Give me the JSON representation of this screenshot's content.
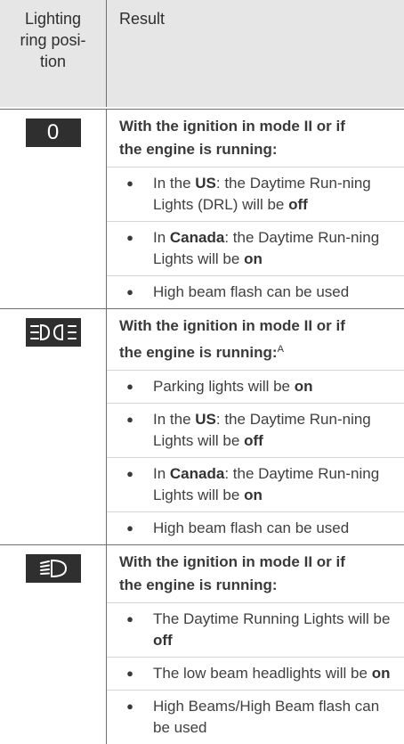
{
  "header": {
    "left_line1": "Lighting",
    "left_line2": "ring posi-",
    "left_line3": "tion",
    "right": "Result"
  },
  "sections": [
    {
      "badge_label": "0",
      "condition_line1": "With the ignition in mode II or if",
      "condition_line2": "the engine is running:",
      "footnote": "",
      "items": [
        {
          "pre": "In the ",
          "b1": "US",
          "mid": ": the Daytime Run-ning Lights (DRL) will be ",
          "b2": "off"
        },
        {
          "pre": "In ",
          "b1": "Canada",
          "mid": ": the Daytime Run-ning Lights will be ",
          "b2": "on"
        },
        {
          "pre": "High beam flash can be used",
          "b1": "",
          "mid": "",
          "b2": ""
        }
      ]
    },
    {
      "badge_icon": "parking-lights-icon",
      "condition_line1": "With the ignition in mode II or if",
      "condition_line2": "the engine is running:",
      "footnote": "A",
      "items": [
        {
          "pre": "Parking lights will be ",
          "b1": "on",
          "mid": "",
          "b2": ""
        },
        {
          "pre": "In the ",
          "b1": "US",
          "mid": ": the Daytime Run-ning Lights will be ",
          "b2": "off"
        },
        {
          "pre": "In ",
          "b1": "Canada",
          "mid": ": the Daytime Run-ning Lights will be ",
          "b2": "on"
        },
        {
          "pre": "High beam flash can be used",
          "b1": "",
          "mid": "",
          "b2": ""
        }
      ]
    },
    {
      "badge_icon": "low-beam-icon",
      "condition_line1": "With the ignition in mode II or if",
      "condition_line2": "the engine is running:",
      "footnote": "",
      "items": [
        {
          "pre": "The Daytime Running Lights will be ",
          "b1": "off",
          "mid": "",
          "b2": ""
        },
        {
          "pre": "The low beam headlights will be ",
          "b1": "on",
          "mid": "",
          "b2": ""
        },
        {
          "pre": "High Beams/High Beam flash can be used",
          "b1": "",
          "mid": "",
          "b2": ""
        }
      ]
    }
  ],
  "bullet_char": "●"
}
